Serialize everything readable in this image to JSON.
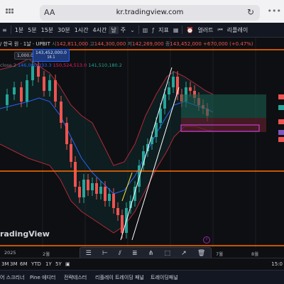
{
  "browser": {
    "url": "kr.tradingview.com",
    "text_size_label": "AA",
    "reload_icon": "reload-icon"
  },
  "toolbar": {
    "items": [
      "1분",
      "5분",
      "15분",
      "30분",
      "1시간",
      "4시간",
      "날",
      "주"
    ],
    "active_index": 6,
    "indicators_label": "지표",
    "alert_label": "얼러트",
    "replay_label": "리플레이"
  },
  "legend": {
    "symbol": "/ 한국 원 · 1날 · UPBIT",
    "open_label": "시",
    "open_value": "142,811,000",
    "high_label": "고",
    "high_value": "144,300,000",
    "low_label": "저",
    "low_value": "142,269,000",
    "close_label": "종",
    "close_value": "143,452,000",
    "change": "+670,000 (+0.47%)",
    "price_pill_white": "1,000.0",
    "price_pill_blue": "143,452,000.0",
    "price_pill_blue_sub": "16.1"
  },
  "indicator": {
    "label": "close 2",
    "basis": "146,000,333.3",
    "upper": "150,524,513.0",
    "lower": "141,510,180.2"
  },
  "watermark": "radingView",
  "time_axis": {
    "labels": [
      "2025",
      "2월",
      "7월",
      "8월"
    ]
  },
  "drawing_toolbar": {
    "icons": [
      "list-icon",
      "horizontal-ray-icon",
      "channel-icon",
      "fib-icon",
      "pitchfork-icon",
      "rectangle-icon",
      "measure-icon",
      "trash-icon"
    ]
  },
  "range_bar": {
    "items": [
      "3M",
      "3M",
      "6M",
      "YTD",
      "1Y",
      "5Y"
    ],
    "time": "15:0"
  },
  "bottom_panels": {
    "items": [
      "어 스크리너",
      "Pine 에디터",
      "전략테스터",
      "리플레이 트레이딩 패널",
      "트레이딩패널"
    ]
  },
  "chart_data": {
    "type": "line",
    "title": "",
    "levels": [
      70,
      241,
      346
    ],
    "level_color": "#ff6d00",
    "up_color": "#26a69a",
    "down_color": "#ef5350"
  }
}
